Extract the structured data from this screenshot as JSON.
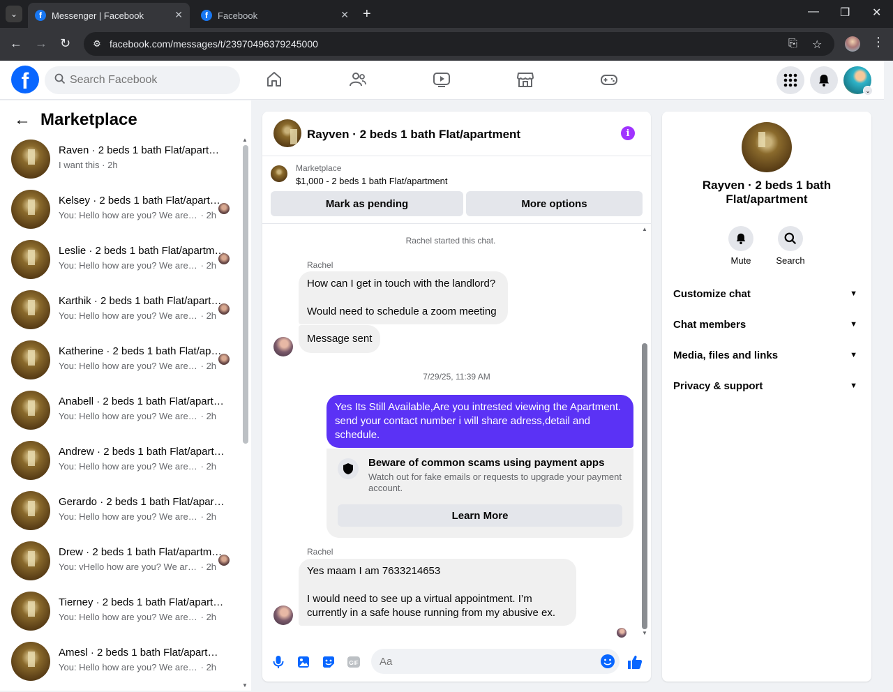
{
  "browser": {
    "tabs": [
      {
        "title": "Messenger | Facebook",
        "active": true
      },
      {
        "title": "Facebook",
        "active": false
      }
    ],
    "url": "facebook.com/messages/t/23970496379245000"
  },
  "header": {
    "search_placeholder": "Search Facebook",
    "nav_icons": [
      "home-icon",
      "friends-icon",
      "video-icon",
      "marketplace-icon",
      "gaming-icon"
    ],
    "right_icons": [
      "menu-grid-icon",
      "notifications-icon",
      "account-avatar"
    ]
  },
  "sidebar": {
    "title": "Marketplace",
    "conversations": [
      {
        "name": "Raven · 2 beds 1 bath Flat/apartment",
        "preview": "I want this",
        "time": "2h"
      },
      {
        "name": "Kelsey · 2 beds 1 bath Flat/apartment",
        "preview": "You: Hello how are you? We are ...",
        "time": "2h"
      },
      {
        "name": "Leslie · 2 beds 1 bath Flat/apartment",
        "preview": "You: Hello how are you? We are ...",
        "time": "2h"
      },
      {
        "name": "Karthik · 2 beds 1 bath Flat/apartment",
        "preview": "You: Hello how are you? We are ...",
        "time": "2h"
      },
      {
        "name": "Katherine · 2 beds 1 bath Flat/apartment",
        "preview": "You: Hello how are you? We are ...",
        "time": "2h"
      },
      {
        "name": "Anabell · 2 beds 1 bath Flat/apartment",
        "preview": "You: Hello how are you? We are rea...",
        "time": "2h"
      },
      {
        "name": "Andrew · 2 beds 1 bath Flat/apartment",
        "preview": "You: Hello how are you? We are rea...",
        "time": "2h"
      },
      {
        "name": "Gerardo · 2 beds 1 bath Flat/apartment",
        "preview": "You: Hello how are you? We are rea...",
        "time": "2h"
      },
      {
        "name": "Drew · 2 beds 1 bath Flat/apartment",
        "preview": "You: vHello how are you? We are...",
        "time": "2h"
      },
      {
        "name": "Tierney · 2 beds 1 bath Flat/apartment",
        "preview": "You: Hello how are you? We are rea...",
        "time": "2h"
      },
      {
        "name": "Amesl · 2 beds 1 bath Flat/apartment",
        "preview": "You: Hello how are you? We are rea...",
        "time": "2h"
      }
    ]
  },
  "chat": {
    "title": "Rayven · 2 beds 1 bath Flat/apartment",
    "listing": {
      "label": "Marketplace",
      "price_line": "$1,000 - 2 beds 1 bath Flat/apartment",
      "mark_pending_label": "Mark as pending",
      "more_options_label": "More options"
    },
    "started_text": "Rachel started this chat.",
    "sender_1": "Rachel",
    "msg_1_line1": "How can I get in touch with the landlord?",
    "msg_1_line2": "Would need to schedule a zoom meeting",
    "msg_2": "Message sent",
    "timestamp": "7/29/25, 11:39 AM",
    "outgoing": "Yes Its Still Available,Are you intrested viewing the Apartment. send your contact number i will share adress,detail and schedule.",
    "scam": {
      "title": "Beware of common scams using payment apps",
      "desc": "Watch out for fake emails or requests to upgrade your payment account.",
      "button": "Learn More"
    },
    "sender_2": "Rachel",
    "msg_3_line1": "Yes maam I am 7633214653",
    "msg_3_line2": "I would need to see up a virtual appointment. I’m currently in a safe house running from my abusive ex.",
    "composer_placeholder": "Aa",
    "accent_color": "#5b32f5"
  },
  "details": {
    "name": "Rayven · 2 beds 1 bath Flat/apartment",
    "actions": [
      {
        "label": "Mute"
      },
      {
        "label": "Search"
      }
    ],
    "sections": [
      {
        "label": "Customize chat"
      },
      {
        "label": "Chat members"
      },
      {
        "label": "Media, files and links"
      },
      {
        "label": "Privacy & support"
      }
    ]
  }
}
